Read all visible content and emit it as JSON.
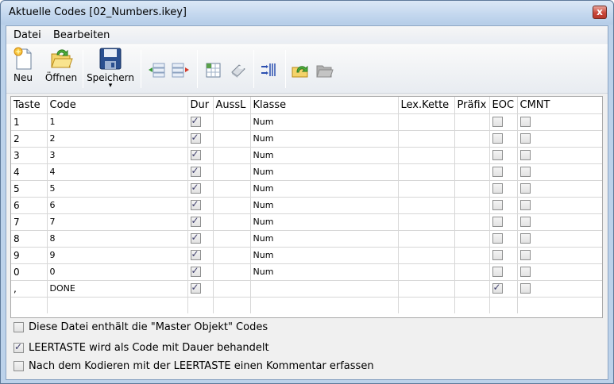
{
  "window": {
    "title": "Aktuelle Codes [02_Numbers.ikey]",
    "close_label": "x"
  },
  "menu": [
    "Datei",
    "Bearbeiten"
  ],
  "toolbar": {
    "new_label": "Neu",
    "open_label": "Öffnen",
    "save_label": "Speichern",
    "save_dropdown": "▾"
  },
  "columns": [
    "Taste",
    "Code",
    "Dur",
    "AussL",
    "Klasse",
    "Lex.Kette",
    "Präfix",
    "EOC",
    "CMNT"
  ],
  "rows": [
    {
      "taste": "1",
      "code": "1",
      "dur": true,
      "klasse": "Num",
      "eoc": false,
      "cmnt": false
    },
    {
      "taste": "2",
      "code": "2",
      "dur": true,
      "klasse": "Num",
      "eoc": false,
      "cmnt": false
    },
    {
      "taste": "3",
      "code": "3",
      "dur": true,
      "klasse": "Num",
      "eoc": false,
      "cmnt": false
    },
    {
      "taste": "4",
      "code": "4",
      "dur": true,
      "klasse": "Num",
      "eoc": false,
      "cmnt": false
    },
    {
      "taste": "5",
      "code": "5",
      "dur": true,
      "klasse": "Num",
      "eoc": false,
      "cmnt": false
    },
    {
      "taste": "6",
      "code": "6",
      "dur": true,
      "klasse": "Num",
      "eoc": false,
      "cmnt": false
    },
    {
      "taste": "7",
      "code": "7",
      "dur": true,
      "klasse": "Num",
      "eoc": false,
      "cmnt": false
    },
    {
      "taste": "8",
      "code": "8",
      "dur": true,
      "klasse": "Num",
      "eoc": false,
      "cmnt": false
    },
    {
      "taste": "9",
      "code": "9",
      "dur": true,
      "klasse": "Num",
      "eoc": false,
      "cmnt": false
    },
    {
      "taste": "0",
      "code": "0",
      "dur": true,
      "klasse": "Num",
      "eoc": false,
      "cmnt": false
    },
    {
      "taste": ",",
      "code": "DONE",
      "dur": true,
      "klasse": "",
      "eoc": true,
      "cmnt": false
    }
  ],
  "options": [
    {
      "label": "Diese Datei enthält die \"Master Objekt\" Codes",
      "checked": false
    },
    {
      "label": "LEERTASTE wird als Code mit Dauer behandelt",
      "checked": true
    },
    {
      "label": "Nach dem Kodieren mit der LEERTASTE einen Kommentar erfassen",
      "checked": false
    }
  ]
}
